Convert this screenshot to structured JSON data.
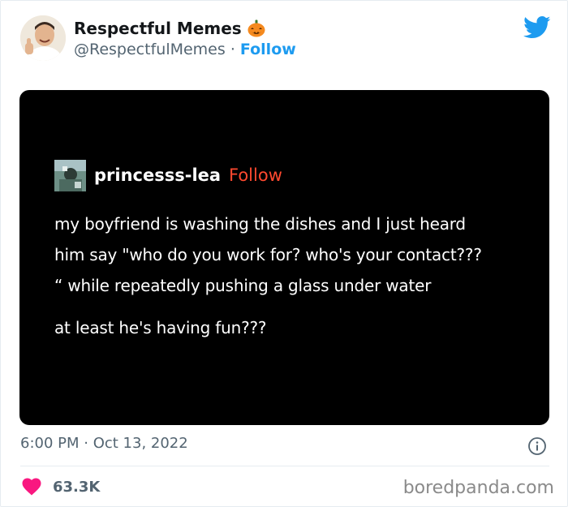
{
  "tweet": {
    "display_name": "Respectful Memes",
    "name_emoji": "pumpkin-emoji",
    "handle": "@RespectfulMemes",
    "separator": " · ",
    "follow_label": "Follow",
    "timestamp": "6:00 PM · Oct 13, 2022",
    "likes": "63.3K"
  },
  "embedded_post": {
    "username": "princesss-lea",
    "follow_label": "Follow",
    "lines": [
      "my boyfriend is washing the dishes and I just heard",
      "him say \"who do you work for? who's your contact???",
      "“ while repeatedly pushing a glass under water",
      "at least he's having fun???"
    ]
  },
  "watermark": "boredpanda.com",
  "colors": {
    "twitter_blue": "#1d9bf0",
    "tumblr_follow": "#ff492f",
    "heart": "#f91880",
    "muted_text": "#536471"
  },
  "icons": [
    "twitter-bird-icon",
    "info-icon",
    "heart-icon",
    "pumpkin-emoji"
  ]
}
